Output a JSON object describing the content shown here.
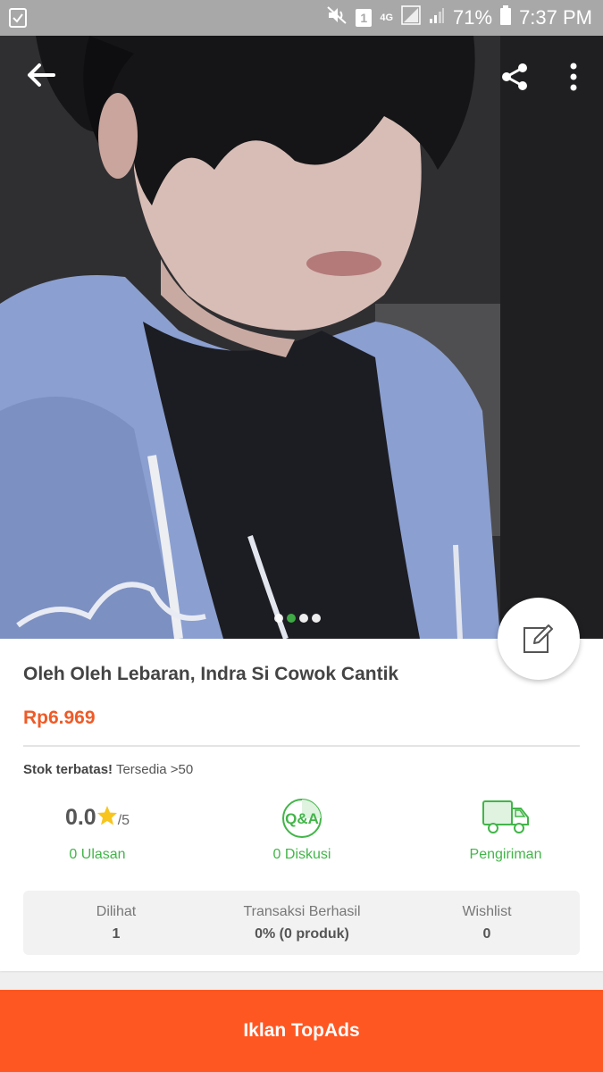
{
  "status_bar": {
    "battery_percent": "71%",
    "time": "7:37 PM",
    "sim_badge": "1",
    "network": "4G"
  },
  "product": {
    "title": "Oleh Oleh Lebaran, Indra Si Cowok Cantik",
    "price": "Rp6.969",
    "stock_label": "Stok terbatas!",
    "stock_value": "Tersedia >50",
    "image_count": 4,
    "active_image": 1
  },
  "stats": {
    "rating": "0.0",
    "rating_max": "/5",
    "reviews_label": "0 Ulasan",
    "qa_icon_text": "Q&A",
    "discussion_label": "0 Diskusi",
    "shipping_label": "Pengiriman"
  },
  "info": {
    "viewed_label": "Dilihat",
    "viewed_value": "1",
    "transactions_label": "Transaksi Berhasil",
    "transactions_value": "0% (0 produk)",
    "wishlist_label": "Wishlist",
    "wishlist_value": "0"
  },
  "bottom_button": {
    "label": "Iklan TopAds"
  },
  "colors": {
    "accent_green": "#42b549",
    "price_orange": "#ef5a27",
    "button_orange": "#ff5722",
    "star_yellow": "#f7c51d"
  }
}
